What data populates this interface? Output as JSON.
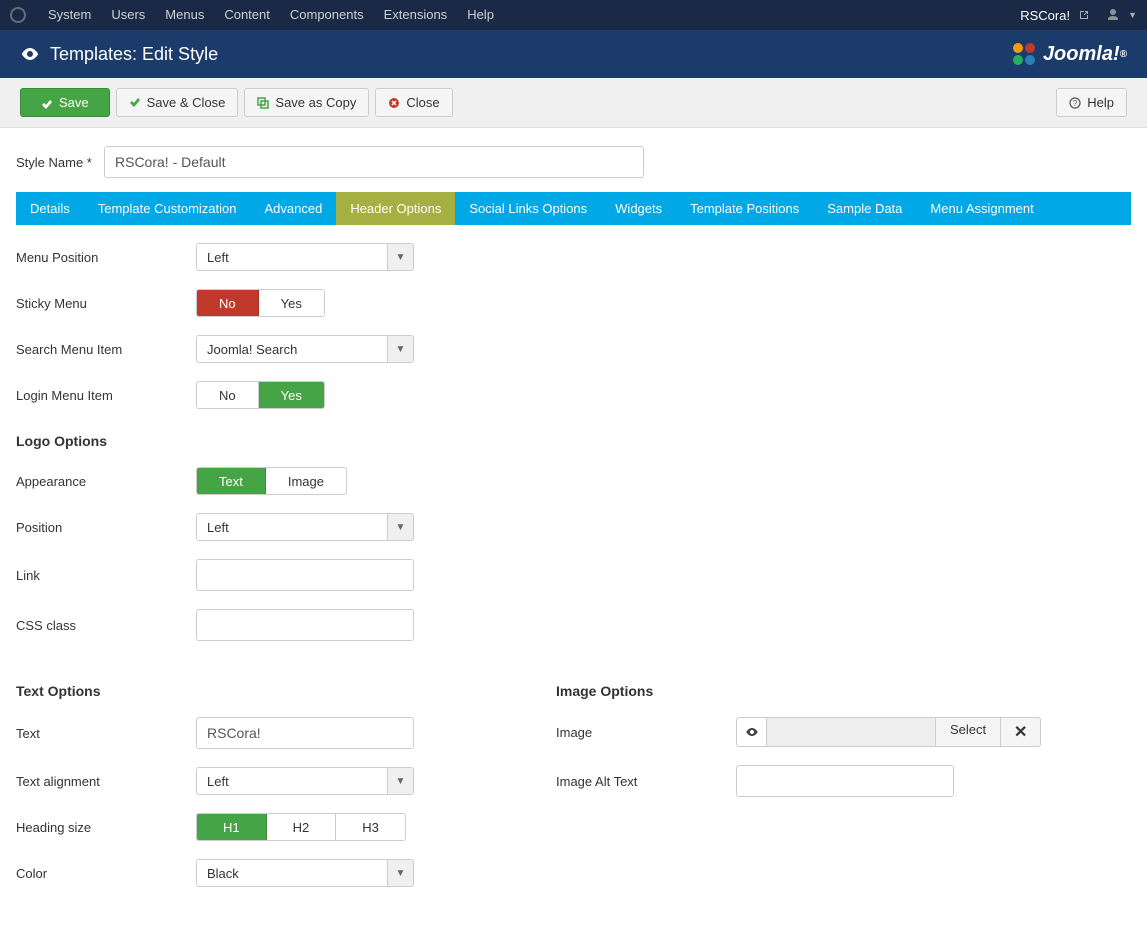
{
  "topbar": {
    "menus": [
      "System",
      "Users",
      "Menus",
      "Content",
      "Components",
      "Extensions",
      "Help"
    ],
    "sitename": "RSCora!"
  },
  "header": {
    "title": "Templates: Edit Style",
    "logo_text": "Joomla!"
  },
  "toolbar": {
    "save": "Save",
    "save_close": "Save & Close",
    "save_copy": "Save as Copy",
    "close": "Close",
    "help": "Help"
  },
  "style_name_label": "Style Name *",
  "style_name_value": "RSCora! - Default",
  "tabs": [
    "Details",
    "Template Customization",
    "Advanced",
    "Header Options",
    "Social Links Options",
    "Widgets",
    "Template Positions",
    "Sample Data",
    "Menu Assignment"
  ],
  "active_tab_index": 3,
  "fields": {
    "menu_position": {
      "label": "Menu Position",
      "value": "Left"
    },
    "sticky_menu": {
      "label": "Sticky Menu",
      "no": "No",
      "yes": "Yes"
    },
    "search_menu_item": {
      "label": "Search Menu Item",
      "value": "Joomla! Search"
    },
    "login_menu_item": {
      "label": "Login Menu Item",
      "no": "No",
      "yes": "Yes"
    },
    "logo_options_heading": "Logo Options",
    "appearance": {
      "label": "Appearance",
      "text": "Text",
      "image": "Image"
    },
    "position": {
      "label": "Position",
      "value": "Left"
    },
    "link": {
      "label": "Link",
      "value": ""
    },
    "css_class": {
      "label": "CSS class",
      "value": ""
    },
    "text_options_heading": "Text Options",
    "image_options_heading": "Image Options",
    "text": {
      "label": "Text",
      "value": "RSCora!"
    },
    "text_alignment": {
      "label": "Text alignment",
      "value": "Left"
    },
    "heading_size": {
      "label": "Heading size",
      "h1": "H1",
      "h2": "H2",
      "h3": "H3"
    },
    "color": {
      "label": "Color",
      "value": "Black"
    },
    "image": {
      "label": "Image",
      "select": "Select"
    },
    "image_alt": {
      "label": "Image Alt Text",
      "value": ""
    }
  }
}
